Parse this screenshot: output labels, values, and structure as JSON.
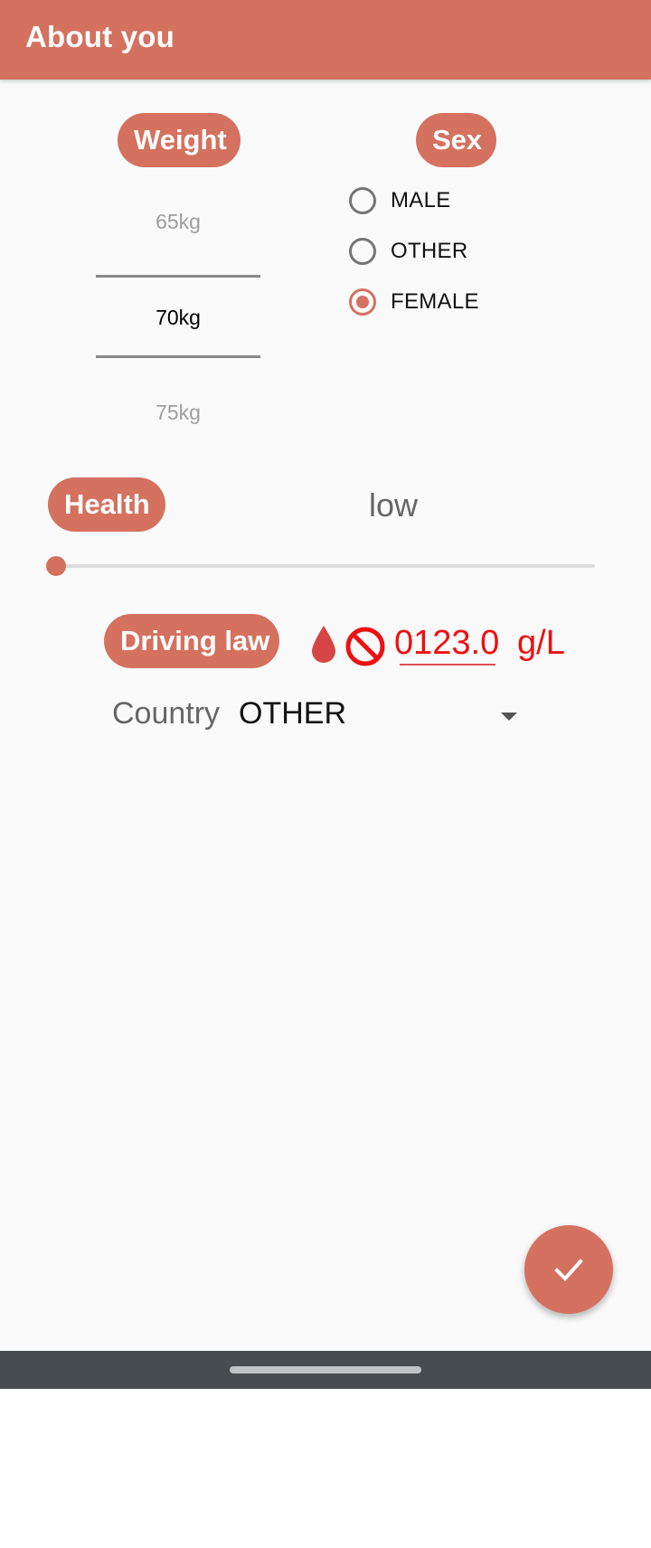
{
  "toolbar": {
    "title": "About you"
  },
  "weight": {
    "label": "Weight",
    "options_visible": [
      "65kg",
      "70kg",
      "75kg"
    ],
    "selected": "70kg"
  },
  "sex": {
    "label": "Sex",
    "options": [
      {
        "label": "MALE",
        "checked": false
      },
      {
        "label": "OTHER",
        "checked": false
      },
      {
        "label": "FEMALE",
        "checked": true
      }
    ]
  },
  "health": {
    "label": "Health",
    "value_text": "low",
    "slider_fraction": 0.0
  },
  "driving_law": {
    "label": "Driving law",
    "bac_value": "0123.0",
    "bac_unit": "g/L",
    "icons": [
      "blood-drop-icon",
      "no-entry-icon"
    ]
  },
  "country": {
    "label": "Country",
    "selected": "OTHER"
  },
  "fab": {
    "icon": "check-icon"
  },
  "colors": {
    "accent": "#d4715f",
    "alert_red": "#ee1111",
    "background": "#fafafa",
    "nav_bar": "#464c50"
  }
}
